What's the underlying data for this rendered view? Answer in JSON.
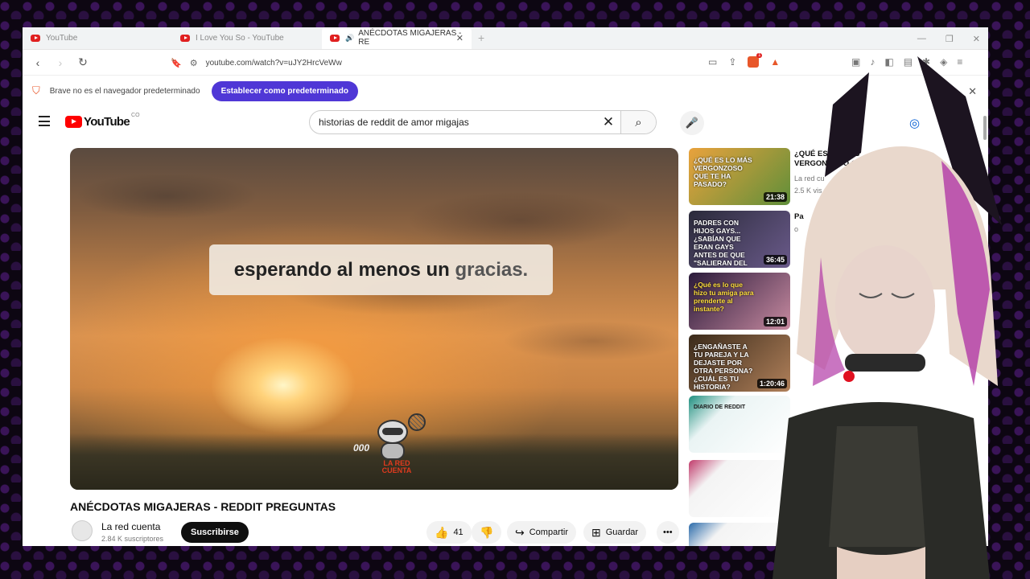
{
  "tabs": [
    {
      "title": "YouTube"
    },
    {
      "title": "I Love You So - YouTube"
    },
    {
      "title": "ANÉCDOTAS MIGAJERAS - RE"
    }
  ],
  "browser": {
    "url": "youtube.com/watch?v=uJY2HrcVeWw",
    "shield_badge": "1"
  },
  "infobar": {
    "message": "Brave no es el navegador predeterminado",
    "button": "Establecer como predeterminado"
  },
  "youtube": {
    "logo_text": "YouTube",
    "country_code": "CO",
    "search_query": "historias de reddit de amor migajas"
  },
  "player": {
    "subtitle_main": "esperando al menos un",
    "subtitle_highlight": "gracias.",
    "mascot_brand": "LA RED CUENTA",
    "mascot_sound": "000"
  },
  "video": {
    "title": "ANÉCDOTAS MIGAJERAS - REDDIT PREGUNTAS",
    "channel": "La red cuenta",
    "subscribers": "2.84 K suscriptores",
    "subscribe_label": "Suscribirse",
    "likes": "41",
    "share_label": "Compartir",
    "save_label": "Guardar"
  },
  "related": [
    {
      "thumb_text": "¿QUÉ ES LO MÁS VERGONZOSO QUE TE HA PASADO?",
      "duration": "21:38",
      "title": "¿QUÉ ES LO MÁS VERGONZOSO QUE TE H",
      "channel": "La red cu",
      "views": "2.5 K vis"
    },
    {
      "thumb_text": "PADRES CON HIJOS GAYS... ¿SABÍAN QUE ERAN GAYS ANTES DE QUE \"SALIERAN DEL CLOSET\"?",
      "duration": "36:45",
      "title": "Pa",
      "channel": "o"
    },
    {
      "thumb_text": "¿Qué es lo que hizo tu amiga para prenderte al instante?",
      "duration": "12:01"
    },
    {
      "thumb_text": "¿ENGAÑASTE A TU PAREJA Y LA DEJASTE POR OTRA PERSONA? ¿CUÁL ES TU HISTORIA?",
      "duration": "1:20:46"
    },
    {
      "thumb_text": "DIARIO DE REDDIT"
    },
    {
      "thumb_text": ""
    },
    {
      "thumb_text": ""
    }
  ],
  "colors": {
    "accent": "#4f37d6",
    "yt_red": "#ff0000",
    "brave": "#e8572a"
  }
}
